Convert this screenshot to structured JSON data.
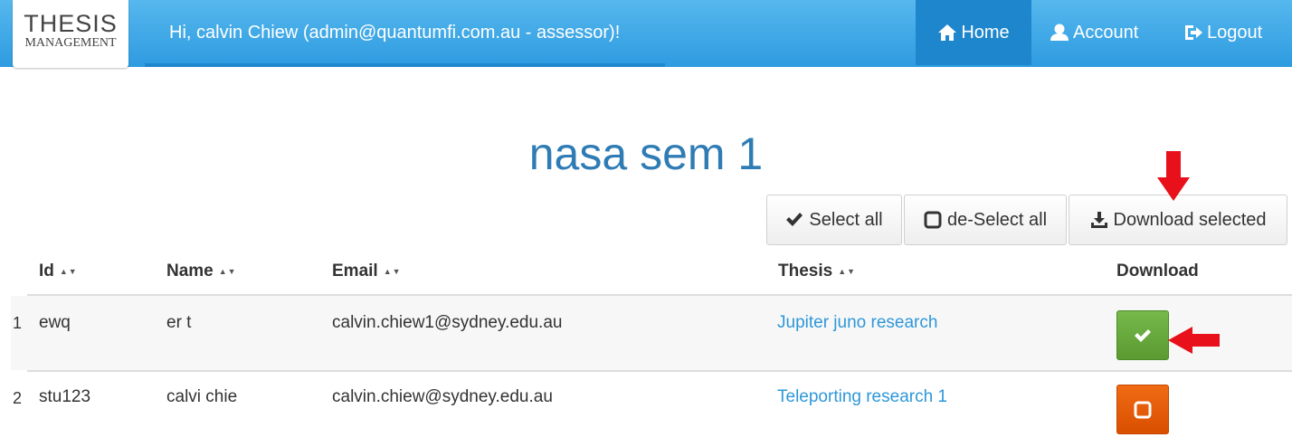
{
  "brand": {
    "line1": "THESIS",
    "line2": "MANAGEMENT"
  },
  "header": {
    "greeting": "Hi, calvin Chiew (admin@quantumfi.com.au - assessor)!"
  },
  "nav": [
    {
      "label": "Home",
      "icon": "home-icon",
      "active": true
    },
    {
      "label": "Account",
      "icon": "user-icon",
      "active": false
    },
    {
      "label": "Logout",
      "icon": "logout-icon",
      "active": false
    }
  ],
  "page": {
    "title": "nasa sem 1"
  },
  "actions": {
    "select_all": "Select all",
    "deselect_all": "de-Select all",
    "download_selected": "Download selected"
  },
  "table": {
    "columns": [
      "Id",
      "Name",
      "Email",
      "Thesis",
      "Download"
    ],
    "rows": [
      {
        "num": "1",
        "id": "ewq",
        "name": "er t",
        "email": "calvin.chiew1@sydney.edu.au",
        "thesis": "Jupiter juno research",
        "selected": true
      },
      {
        "num": "2",
        "id": "stu123",
        "name": "calvi chie",
        "email": "calvin.chiew@sydney.edu.au",
        "thesis": "Teleporting research 1",
        "selected": false
      }
    ]
  },
  "colors": {
    "nav_gradient_top": "#56b8ee",
    "nav_gradient_bottom": "#2e9be0",
    "title": "#2f7cb5",
    "link": "#2e97d8",
    "selected_button": "#6aab3e",
    "unselected_button": "#e85d0b",
    "annotation_arrow": "#e8101a"
  }
}
